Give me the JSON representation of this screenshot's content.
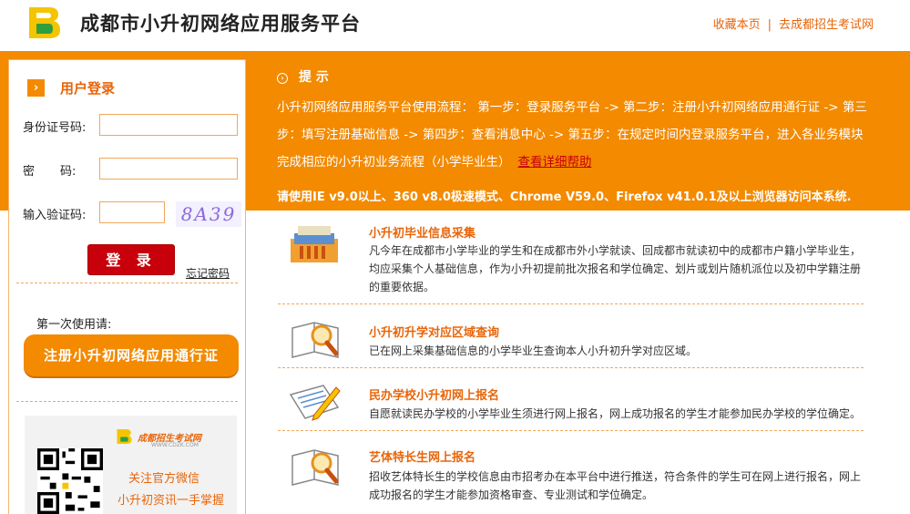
{
  "header": {
    "site_title": "成都市小升初网络应用服务平台",
    "link_bookmark": "收藏本页",
    "separator": "|",
    "link_exam_site": "去成都招生考试网"
  },
  "login": {
    "title": "用户登录",
    "id_label": "身份证号码:",
    "password_label_1": "密",
    "password_label_2": "码:",
    "captcha_label": "输入验证码:",
    "captcha_text": "8A39",
    "login_button": "登 录",
    "forgot_link": "忘记密码",
    "first_use": "第一次使用请:",
    "register_button": "注册小升初网络应用通行证"
  },
  "promo": {
    "brand": "成都招生考试网",
    "brand_url": "WWW.CDZK.COM",
    "follow_wechat": "关注官方微信",
    "tagline": "小升初资讯一手掌握"
  },
  "tips": {
    "heading": "提  示",
    "flow": "小升初网络应用服务平台使用流程：  第一步：登录服务平台 -> 第二步：注册小升初网络应用通行证 -> 第三步：填写注册基础信息 -> 第四步：查看消息中心 -> 第五步：在规定时间内登录服务平台，进入各业务模块完成相应的小升初业务流程（小学毕业生）",
    "help_link": "查看详细帮助",
    "browser_notice": "请使用IE v9.0以上、360 v8.0极速模式、Chrome V59.0、Firefox v41.0.1及以上浏览器访问本系统."
  },
  "services": [
    {
      "title": "小升初毕业信息采集",
      "desc": "凡今年在成都市小学毕业的学生和在成都市外小学就读、回成都市就读初中的成都市户籍小学毕业生，均应采集个人基础信息，作为小升初提前批次报名和学位确定、划片或划片随机派位以及初中学籍注册的重要依据。",
      "icon": "books-icon"
    },
    {
      "title": "小升初升学对应区域查询",
      "desc": "已在网上采集基础信息的小学毕业生查询本人小升初升学对应区域。",
      "icon": "magnifier-book-icon"
    },
    {
      "title": "民办学校小升初网上报名",
      "desc": "自愿就读民办学校的小学毕业生须进行网上报名，网上成功报名的学生才能参加民办学校的学位确定。",
      "icon": "pencil-paper-icon"
    },
    {
      "title": "艺体特长生网上报名",
      "desc": "招收艺体特长生的学校信息由市招考办在本平台中进行推送，符合条件的学生可在网上进行报名，网上成功报名的学生才能参加资格审查、专业测试和学位确定。",
      "icon": "magnifier-book-icon"
    }
  ],
  "colors": {
    "brand_orange": "#f38a00",
    "text_orange": "#e8650a",
    "login_red": "#c8000b",
    "logo_green": "#2e9e3f",
    "logo_yellow": "#f5c400"
  }
}
